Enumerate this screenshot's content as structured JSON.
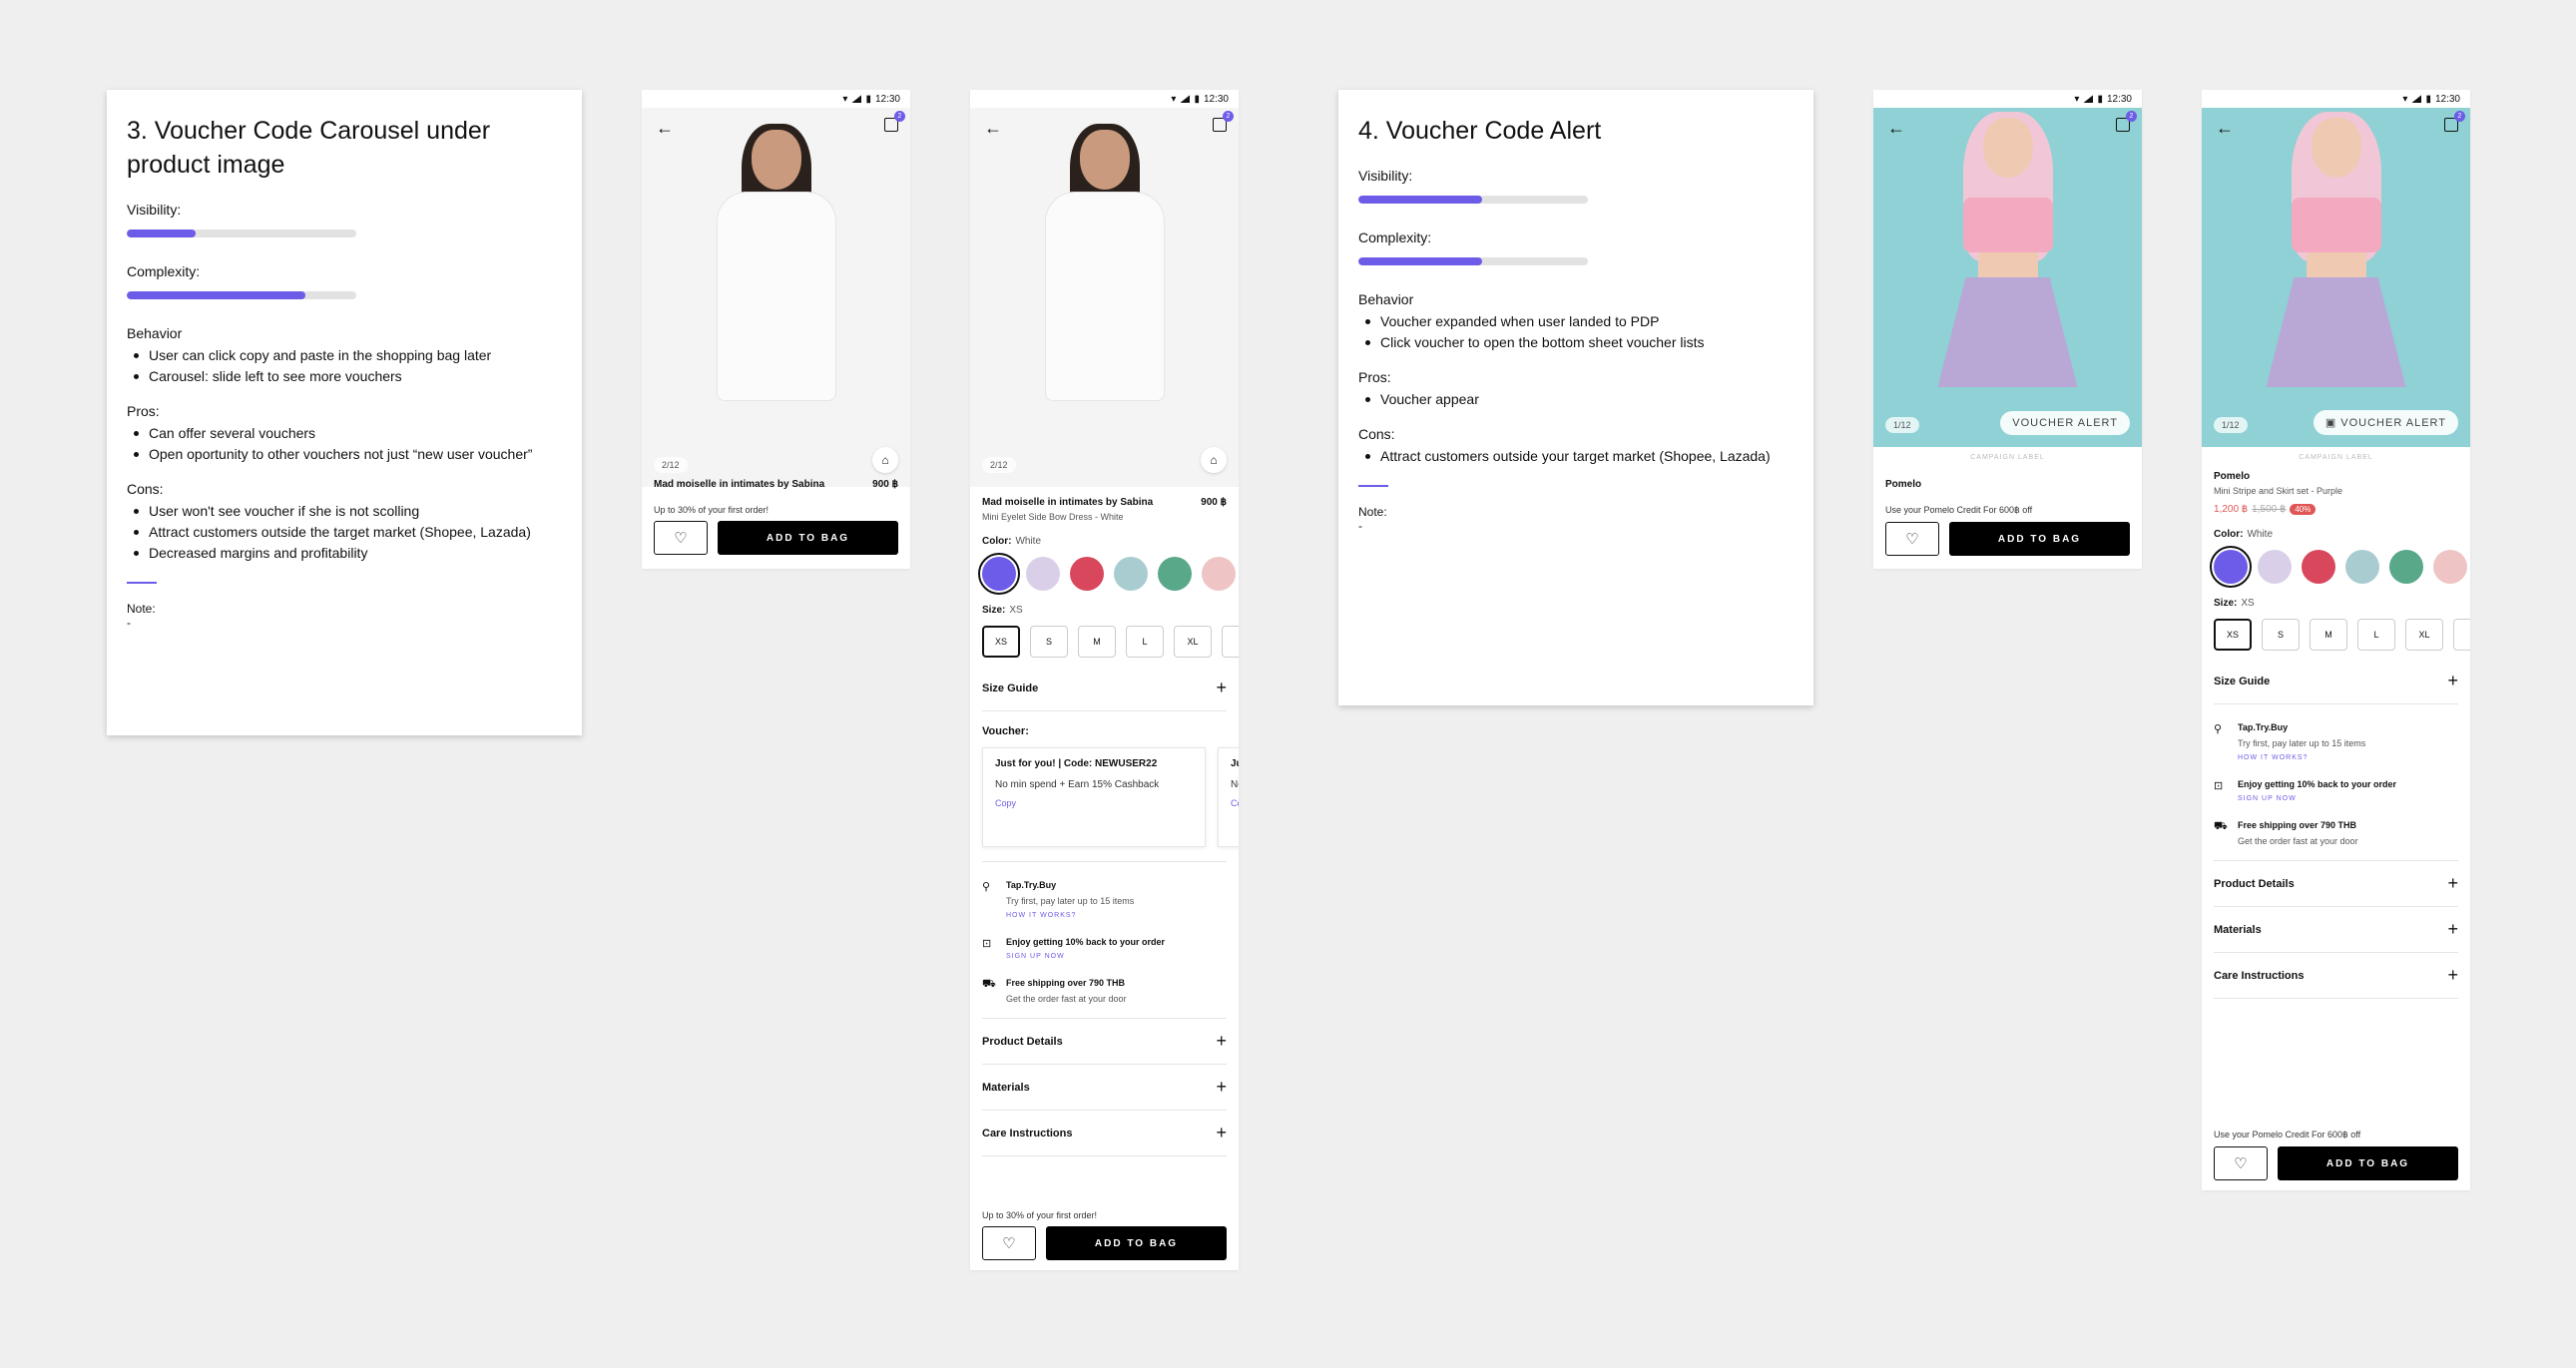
{
  "card3": {
    "title": "3. Voucher Code Carousel under product image",
    "visibility_label": "Visibility:",
    "visibility_level": 0.3,
    "complexity_label": "Complexity:",
    "complexity_level": 0.78,
    "behavior_label": "Behavior",
    "behavior": [
      "User can click copy and paste in the shopping bag later",
      "Carousel: slide left to see more vouchers"
    ],
    "pros_label": "Pros:",
    "pros": [
      "Can offer several vouchers",
      "Open oportunity to other vouchers not just “new user voucher”"
    ],
    "cons_label": "Cons:",
    "cons": [
      "User won't see voucher if she is not scolling",
      "Attract customers outside the target market (Shopee, Lazada)",
      "Decreased margins and profitability"
    ],
    "note_label": "Note:",
    "note_value": "-"
  },
  "card4": {
    "title": "4. Voucher Code Alert",
    "visibility_label": "Visibility:",
    "visibility_level": 0.54,
    "complexity_label": "Complexity:",
    "complexity_level": 0.54,
    "behavior_label": "Behavior",
    "behavior": [
      "Voucher expanded when user landed to PDP",
      "Click voucher to open the bottom sheet voucher lists"
    ],
    "pros_label": "Pros:",
    "pros": [
      "Voucher appear"
    ],
    "cons_label": "Cons:",
    "cons": [
      "Attract customers outside your target market (Shopee, Lazada)"
    ],
    "note_label": "Note:",
    "note_value": "-"
  },
  "status": {
    "time": "12:30"
  },
  "bag_count": "2",
  "phone1": {
    "pager": "2/12",
    "title": "Mad moiselle in intimates by Sabina",
    "price": "900 ฿",
    "promo": "Up to 30% of your first order!",
    "add_to_bag": "ADD TO BAG"
  },
  "phone2": {
    "pager": "2/12",
    "title": "Mad moiselle in intimates by Sabina",
    "price": "900 ฿",
    "product_name": "Mini Eyelet Side Bow Dress - White",
    "color_label": "Color:",
    "color_value": "White",
    "size_label": "Size:",
    "size_value": "XS",
    "sizes": [
      "XS",
      "S",
      "M",
      "L",
      "XL"
    ],
    "size_guide": "Size Guide",
    "voucher_label": "Voucher:",
    "voucher_title": "Just for you! | Code: NEWUSER22",
    "voucher_desc": "No min spend + Earn 15% Cashback",
    "voucher_copy": "Copy",
    "voucher2_title": "Ju",
    "voucher2_desc": "No Ca",
    "voucher2_copy": "Co",
    "perk1_title": "Tap.Try.Buy",
    "perk1_sub": "Try first, pay later up to 15 items",
    "perk1_link": "HOW IT WORKS?",
    "perk2_title": "Enjoy getting 10% back to your order",
    "perk2_link": "SIGN UP NOW",
    "perk3_title": "Free shipping over 790 THB",
    "perk3_sub": "Get the order fast at your door",
    "product_details": "Product Details",
    "materials": "Materials",
    "care": "Care Instructions",
    "promo": "Up to 30% of your first order!",
    "add_to_bag": "ADD TO BAG"
  },
  "phone3": {
    "pager": "1/12",
    "voucher_alert": "VOUCHER ALERT",
    "campaign": "CAMPAIGN LABEL",
    "brand": "Pomelo",
    "promo": "Use your Pomelo Credit For 600฿ off",
    "add_to_bag": "ADD TO BAG"
  },
  "phone4": {
    "pager": "1/12",
    "voucher_alert": "VOUCHER ALERT",
    "campaign": "CAMPAIGN LABEL",
    "brand": "Pomelo",
    "product_name": "Mini Stripe and Skirt set - Purple",
    "price": "1,200 ฿",
    "old_price": "1,500 ฿",
    "discount": "40%",
    "color_label": "Color:",
    "color_value": "White",
    "size_label": "Size:",
    "size_value": "XS",
    "sizes": [
      "XS",
      "S",
      "M",
      "L",
      "XL"
    ],
    "size_guide": "Size Guide",
    "perk1_title": "Tap.Try.Buy",
    "perk1_sub": "Try first, pay later up to 15 items",
    "perk1_link": "HOW IT WORKS?",
    "perk2_title": "Enjoy getting 10% back to your order",
    "perk2_link": "SIGN UP NOW",
    "perk3_title": "Free shipping over 790 THB",
    "perk3_sub": "Get the order fast at your door",
    "product_details": "Product Details",
    "materials": "Materials",
    "care": "Care Instructions",
    "promo": "Use your Pomelo Credit For 600฿ off",
    "add_to_bag": "ADD TO BAG"
  },
  "swatch_colors": [
    "#6c5ce7",
    "#d9cfe8",
    "#d9475c",
    "#a9ccd0",
    "#5aa88a",
    "#efc4c4"
  ],
  "accent": "#6c5ce7"
}
